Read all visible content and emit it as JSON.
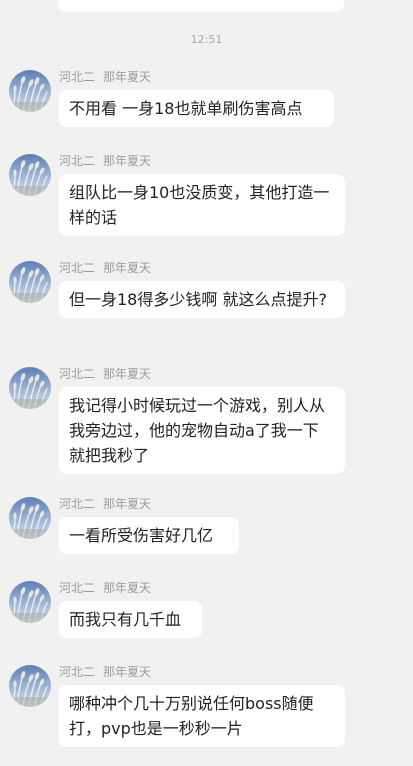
{
  "chat": {
    "previous_bubble_text": "",
    "timestamp": "12:51",
    "messages": [
      {
        "sender": "河北二",
        "title": "那年夏天",
        "text": "不用看 一身18也就单刷伤害高点"
      },
      {
        "sender": "河北二",
        "title": "那年夏天",
        "text": "组队比一身10也没质变，其他打造一样的话"
      },
      {
        "sender": "河北二",
        "title": "那年夏天",
        "text": "但一身18得多少钱啊 就这么点提升?"
      },
      {
        "sender": "河北二",
        "title": "那年夏天",
        "text": "我记得小时候玩过一个游戏，别人从我旁边过，他的宠物自动a了我一下就把我秒了"
      },
      {
        "sender": "河北二",
        "title": "那年夏天",
        "text": "一看所受伤害好几亿"
      },
      {
        "sender": "河北二",
        "title": "那年夏天",
        "text": "而我只有几千血"
      },
      {
        "sender": "河北二",
        "title": "那年夏天",
        "text": "哪种冲个几十万别说任何boss随便打，pvp也是一秒秒一片"
      }
    ]
  }
}
